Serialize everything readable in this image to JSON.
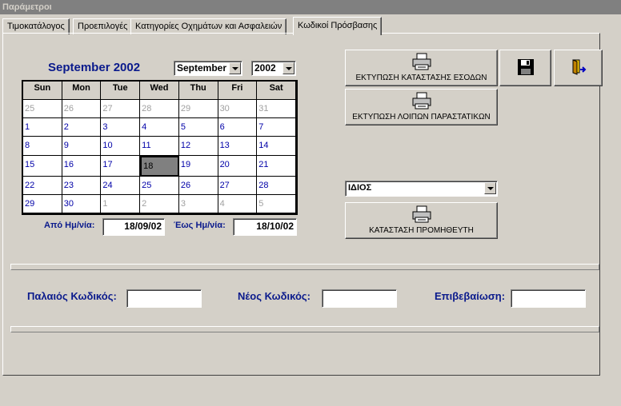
{
  "window": {
    "title": "Παράμετροι"
  },
  "tabs": [
    {
      "label": "Τιμοκατάλογος"
    },
    {
      "label": "Προεπιλογές"
    },
    {
      "label": "Κατηγορίες Οχημάτων και Ασφαλειών"
    },
    {
      "label": "Κωδικοί Πρόσβασης",
      "active": true
    }
  ],
  "calendar": {
    "title": "September 2002",
    "month_select": "September",
    "year_select": "2002",
    "day_headers": [
      "Sun",
      "Mon",
      "Tue",
      "Wed",
      "Thu",
      "Fri",
      "Sat"
    ],
    "weeks": [
      [
        "25",
        "26",
        "27",
        "28",
        "29",
        "30",
        "31"
      ],
      [
        "1",
        "2",
        "3",
        "4",
        "5",
        "6",
        "7"
      ],
      [
        "8",
        "9",
        "10",
        "11",
        "12",
        "13",
        "14"
      ],
      [
        "15",
        "16",
        "17",
        "18",
        "19",
        "20",
        "21"
      ],
      [
        "22",
        "23",
        "24",
        "25",
        "26",
        "27",
        "28"
      ],
      [
        "29",
        "30",
        "1",
        "2",
        "3",
        "4",
        "5"
      ]
    ],
    "selected": "18"
  },
  "date_range": {
    "from_label": "Από Ημ/νία:",
    "from_value": "18/09/02",
    "to_label": "Έως Ημ/νία:",
    "to_value": "18/10/02"
  },
  "buttons": {
    "print_income": "ΕΚΤΥΠΩΣΗ ΚΑΤΑΣΤΑΣΗΣ ΕΣΟΔΩΝ",
    "print_other": "ΕΚΤΥΠΩΣΗ ΛΟΙΠΩΝ ΠΑΡΑΣΤΑΤΙΚΩΝ",
    "supplier_report": "ΚΑΤΑΣΤΑΣΗ ΠΡΟΜΗΘΕΥΤΗ"
  },
  "supplier_select": {
    "value": "ΙΔΙΟΣ"
  },
  "password": {
    "old_label": "Παλαιός Κωδικός:",
    "old_value": "",
    "new_label": "Νέος Κωδικός:",
    "new_value": "",
    "confirm_label": "Επιβεβαίωση:",
    "confirm_value": ""
  },
  "icons": {
    "printer": "printer-icon",
    "save": "floppy-disk-icon",
    "exit": "exit-door-icon"
  }
}
